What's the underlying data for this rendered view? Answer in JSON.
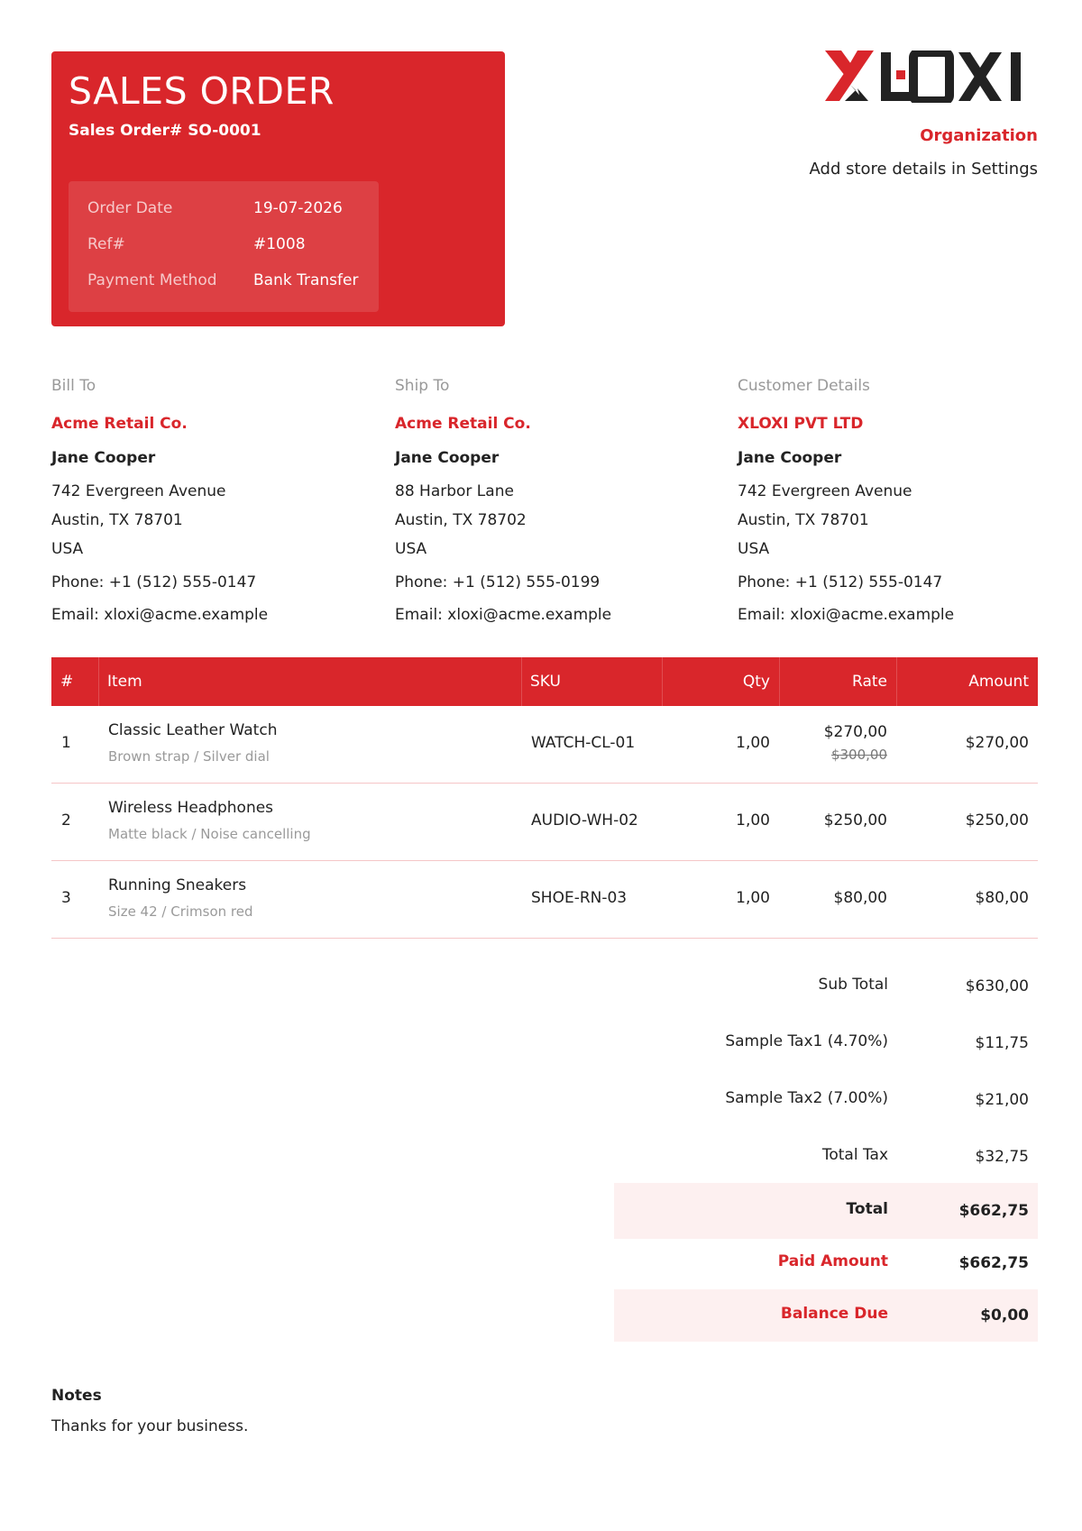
{
  "document": {
    "title": "SALES ORDER",
    "number_label": "Sales Order# SO-0001",
    "meta": [
      {
        "label": "Order Date",
        "value": "19-07-2026"
      },
      {
        "label": "Ref#",
        "value": "#1008"
      },
      {
        "label": "Payment Method",
        "value": "Bank Transfer"
      }
    ]
  },
  "logo": {
    "text": "XLOXI"
  },
  "organization": {
    "name": "Organization",
    "subtitle": "Add store details in Settings"
  },
  "bill_to": {
    "heading": "Bill To",
    "company": "Acme Retail Co.",
    "contact": "Jane Cooper",
    "address1": "742 Evergreen Avenue",
    "address2": "Austin, TX 78701",
    "country": "USA",
    "phone": "Phone: +1 (512) 555-0147",
    "email": "Email: xloxi@acme.example"
  },
  "ship_to": {
    "heading": "Ship To",
    "company": "Acme Retail Co.",
    "contact": "Jane Cooper",
    "address1": "88 Harbor Lane",
    "address2": "Austin, TX 78702",
    "country": "USA",
    "phone": "Phone: +1 (512) 555-0199",
    "email": "Email: xloxi@acme.example"
  },
  "customer": {
    "heading": "Customer Details",
    "company": "XLOXI PVT LTD",
    "contact": "Jane Cooper",
    "address1": "742 Evergreen Avenue",
    "address2": "Austin, TX 78701",
    "country": "USA",
    "phone": "Phone: +1 (512) 555-0147",
    "email": "Email: xloxi@acme.example"
  },
  "table": {
    "headers": [
      "#",
      "Item",
      "SKU",
      "Qty",
      "Rate",
      "Amount"
    ],
    "rows": [
      {
        "num": "1",
        "item": "Classic Leather Watch",
        "desc": "Brown strap / Silver dial",
        "sku": "WATCH-CL-01",
        "qty": "1,00",
        "rate": "$270,00",
        "old_rate": "$300,00",
        "amount": "$270,00"
      },
      {
        "num": "2",
        "item": "Wireless Headphones",
        "desc": "Matte black / Noise cancelling",
        "sku": "AUDIO-WH-02",
        "qty": "1,00",
        "rate": "$250,00",
        "old_rate": "",
        "amount": "$250,00"
      },
      {
        "num": "3",
        "item": "Running Sneakers",
        "desc": "Size 42 / Crimson red",
        "sku": "SHOE-RN-03",
        "qty": "1,00",
        "rate": "$80,00",
        "old_rate": "",
        "amount": "$80,00"
      }
    ]
  },
  "totals": {
    "subtotal_label": "Sub Total",
    "subtotal": "$630,00",
    "tax1_label": "Sample Tax1 (4.70%)",
    "tax1": "$11,75",
    "tax2_label": "Sample Tax2 (7.00%)",
    "tax2": "$21,00",
    "total_tax_label": "Total Tax",
    "total_tax": "$32,75",
    "total_label": "Total",
    "total": "$662,75",
    "paid_label": "Paid Amount",
    "paid": "$662,75",
    "balance_label": "Balance Due",
    "balance": "$0,00"
  },
  "notes": {
    "title": "Notes",
    "text": "Thanks for your business."
  },
  "colors": {
    "accent": "#d9262b",
    "highlight": "#fdf0f0"
  }
}
